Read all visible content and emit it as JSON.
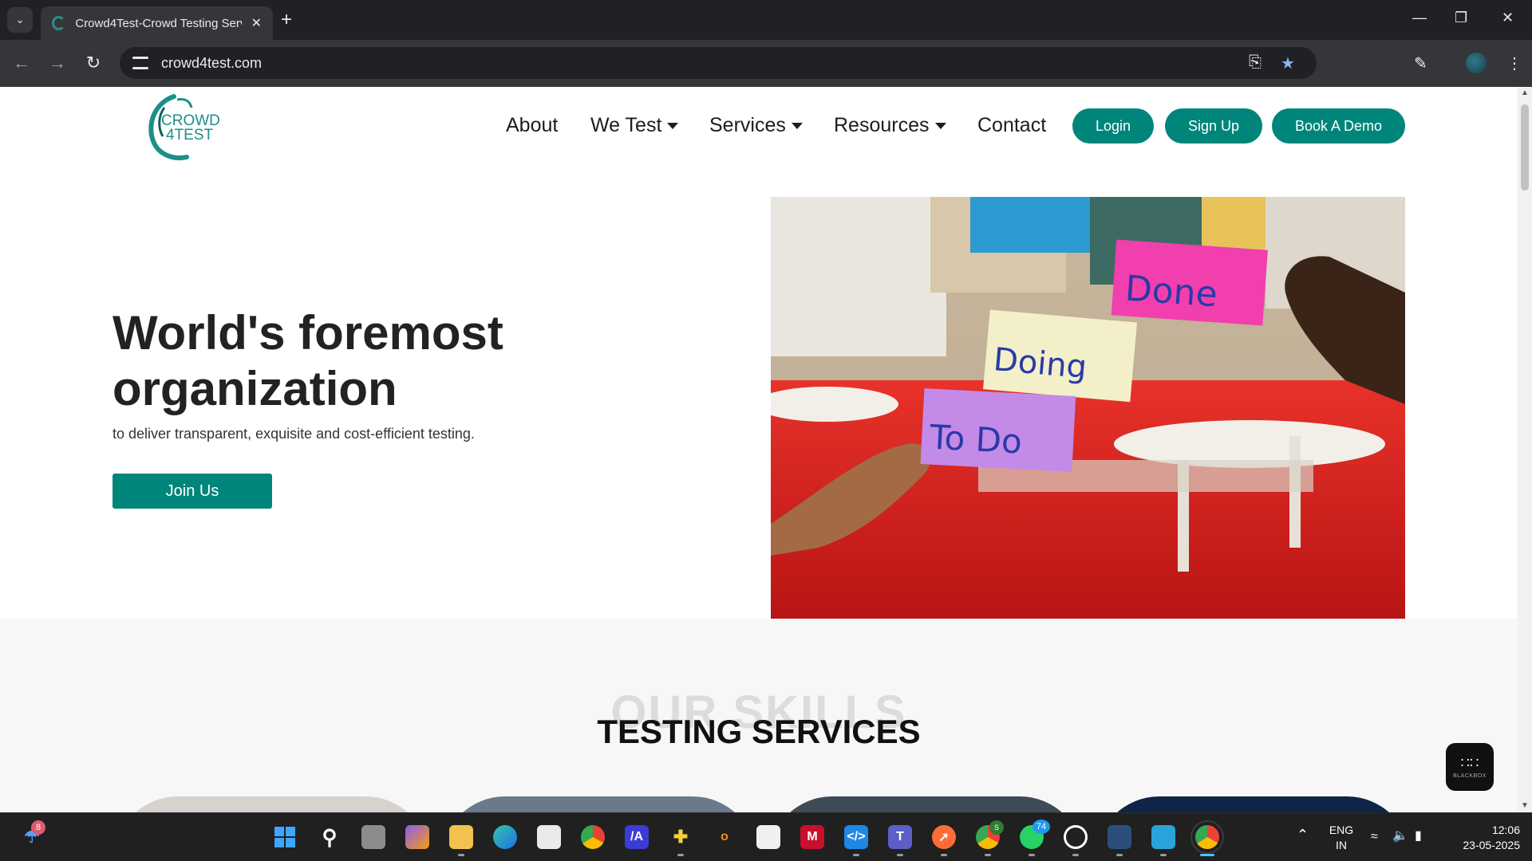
{
  "browser": {
    "tab_title": "Crowd4Test-Crowd Testing Serv",
    "url": "crowd4test.com"
  },
  "site": {
    "logo_text_line1": "CROWD",
    "logo_text_line2": "4TEST",
    "nav": {
      "about": "About",
      "we_test": "We Test",
      "services": "Services",
      "resources": "Resources",
      "contact": "Contact"
    },
    "buttons": {
      "login": "Login",
      "signup": "Sign Up",
      "book_demo": "Book A Demo"
    },
    "accent_color": "#00857a"
  },
  "hero": {
    "title": "World's foremost organization",
    "subtitle": "to deliver transparent, exquisite and cost-efficient testing.",
    "cta": "Join Us",
    "image_notes": {
      "done": "Done",
      "doing": "Doing",
      "todo": "To Do"
    }
  },
  "skills": {
    "ghost_text": "OUR SKILLS",
    "title": "TESTING SERVICES"
  },
  "widget": {
    "label": "BLACKBOX"
  },
  "taskbar": {
    "weather_badge": "8",
    "teams_badge": "S",
    "whatsapp_badge": "74",
    "language_line1": "ENG",
    "language_line2": "IN",
    "time": "12:06",
    "date": "23-05-2025"
  }
}
